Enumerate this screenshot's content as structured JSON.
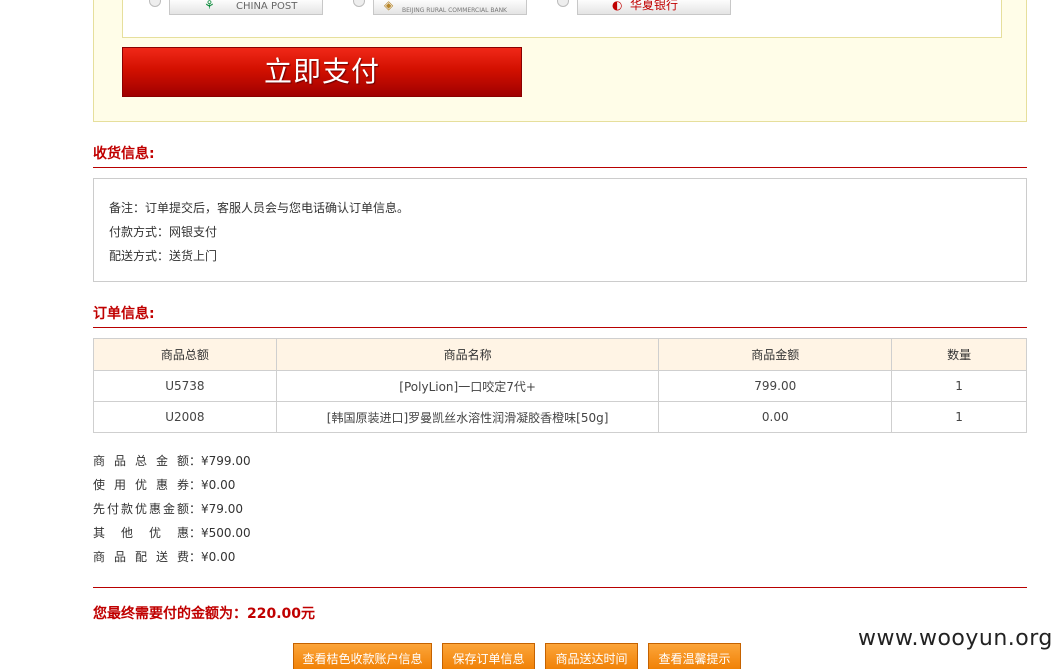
{
  "payment": {
    "banks": [
      {
        "icon": "⚘",
        "name": "CHINA POST",
        "icon_color": "#0a8a3a"
      },
      {
        "icon": "◈",
        "name": "BEIJING RURAL COMMERCIAL BANK",
        "icon_color": "#b8862a"
      },
      {
        "icon": "◐",
        "name": "华夏银行",
        "icon_color": "#c00000"
      }
    ],
    "pay_button": "立即支付"
  },
  "shipping": {
    "title": "收货信息:",
    "note": "备注：订单提交后，客服人员会与您电话确认订单信息。",
    "payment_method": "付款方式：网银支付",
    "delivery_method": "配送方式：送货上门"
  },
  "order": {
    "title": "订单信息:",
    "columns": [
      "商品总额",
      "商品名称",
      "商品金额",
      "数量"
    ],
    "rows": [
      [
        "U5738",
        "[PolyLion]一口咬定7代+",
        "799.00",
        "1"
      ],
      [
        "U2008",
        "[韩国原装进口]罗曼凯丝水溶性润滑凝胶香橙味[50g]",
        "0.00",
        "1"
      ]
    ]
  },
  "summary": [
    {
      "label": "商品总金额",
      "value": "¥799.00"
    },
    {
      "label": "使用优惠券",
      "value": "¥0.00"
    },
    {
      "label": "先付款优惠金额",
      "value": "¥79.00"
    },
    {
      "label": "其他优惠",
      "value": "¥500.00"
    },
    {
      "label": "商品配送费",
      "value": "¥0.00"
    }
  ],
  "final_amount": "您最终需要付的金额为：220.00元",
  "actions": [
    "查看桔色收款账户信息",
    "保存订单信息",
    "商品送达时间",
    "查看温馨提示"
  ],
  "watermark": "www.wooyun.org",
  "colors": {
    "accent_red": "#c00000",
    "button_orange": "#ef7d00",
    "panel_bg": "#fffde8"
  }
}
